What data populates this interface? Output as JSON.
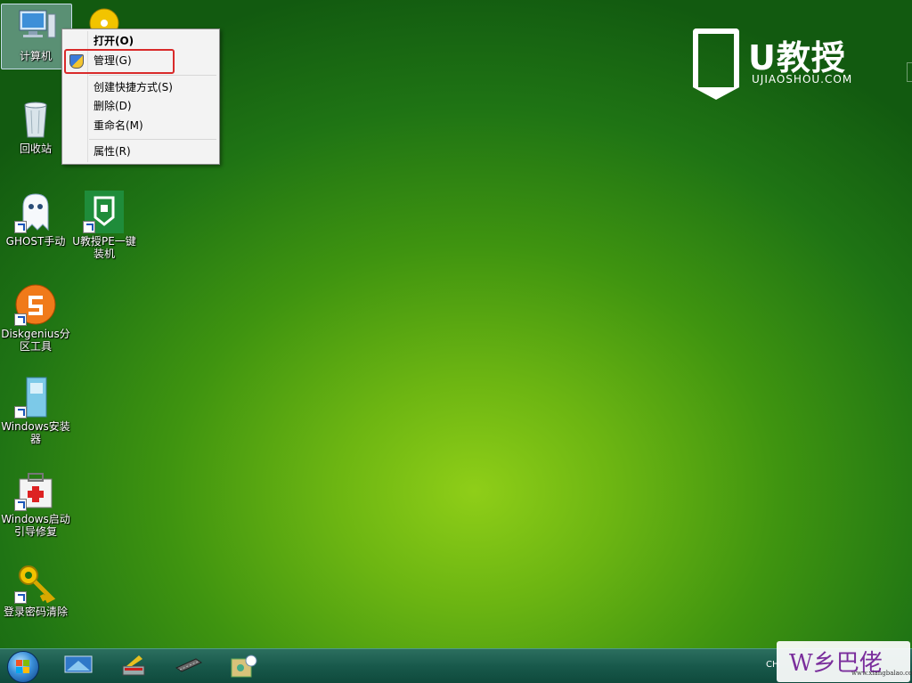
{
  "desktop_icons": [
    {
      "label": "计算机"
    },
    {
      "label": "回收站"
    },
    {
      "label": "GHOST手动"
    },
    {
      "label": "U教授PE一键装机"
    },
    {
      "label": "Diskgenius分区工具"
    },
    {
      "label": "Windows安装器"
    },
    {
      "label": "Windows启动引导修复"
    },
    {
      "label": "登录密码清除"
    }
  ],
  "context_menu": {
    "items": [
      "打开(O)",
      "管理(G)",
      "创建快捷方式(S)",
      "删除(D)",
      "重命名(M)",
      "属性(R)"
    ],
    "highlighted": "管理(G)"
  },
  "brand": {
    "name": "U教授",
    "url": "UJIAOSHOU.COM"
  },
  "taskbar": {
    "apps": [
      "start-button",
      "desktop-app",
      "disk-tool",
      "memory-tool",
      "settings-tool"
    ],
    "tray_text": "CH"
  },
  "watermark": {
    "text": "W乡巴佬",
    "url": "www.xiangbalao.com"
  },
  "colors": {
    "desktop_green": "#4a9a10",
    "taskbar": "#18594b",
    "highlight_red": "#d92a2a"
  }
}
